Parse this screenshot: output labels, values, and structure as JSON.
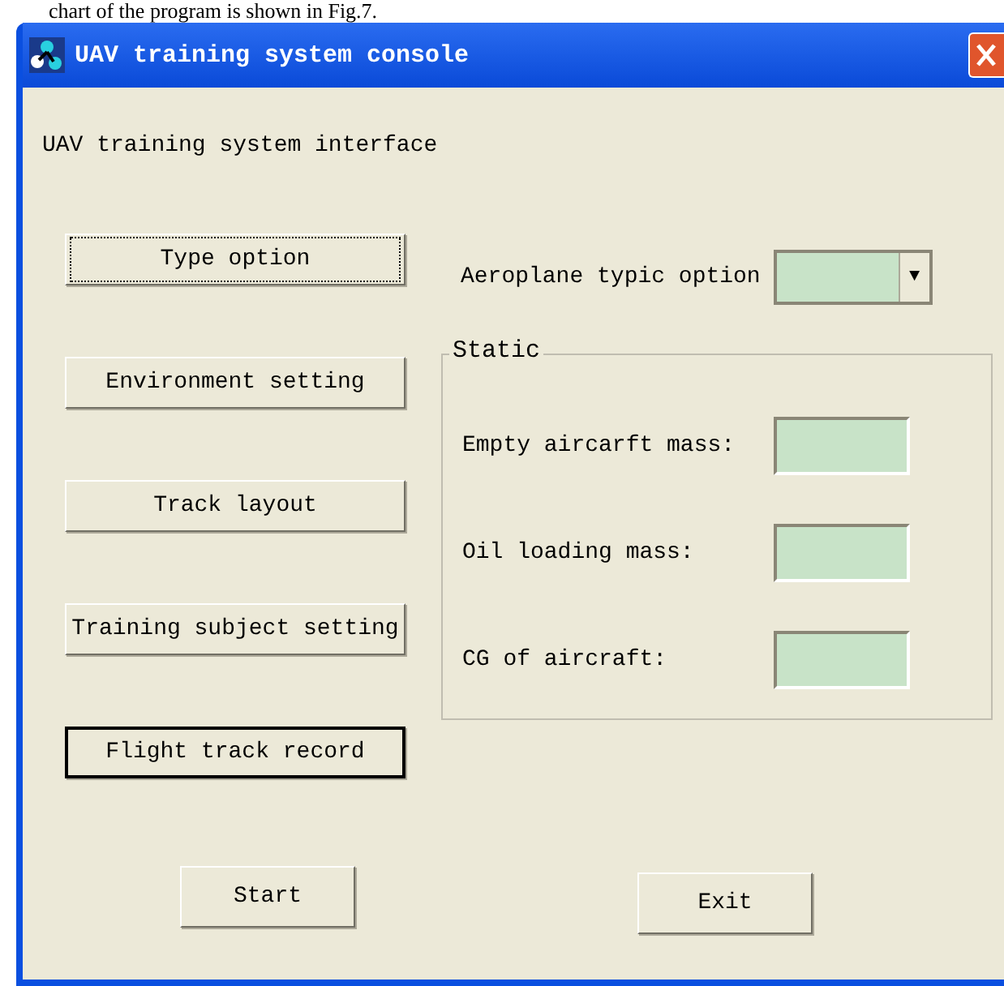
{
  "caption": "chart of the program is shown in Fig.7.",
  "window": {
    "title": "UAV training system console"
  },
  "heading": "UAV training system interface",
  "menu_buttons": [
    {
      "label": "Type option",
      "focused": true,
      "default": false
    },
    {
      "label": "Environment setting",
      "focused": false,
      "default": false
    },
    {
      "label": "Track layout",
      "focused": false,
      "default": false
    },
    {
      "label": "Training subject setting",
      "focused": false,
      "default": false
    },
    {
      "label": "Flight track record",
      "focused": false,
      "default": true
    }
  ],
  "type_select": {
    "label": "Aeroplane typic option",
    "arrow": "▼"
  },
  "group": {
    "title": "Static",
    "fields": [
      {
        "label": "Empty aircarft mass:"
      },
      {
        "label": "Oil loading mass:"
      },
      {
        "label": "CG of aircraft:"
      }
    ]
  },
  "start_button": "Start",
  "exit_button": "Exit"
}
